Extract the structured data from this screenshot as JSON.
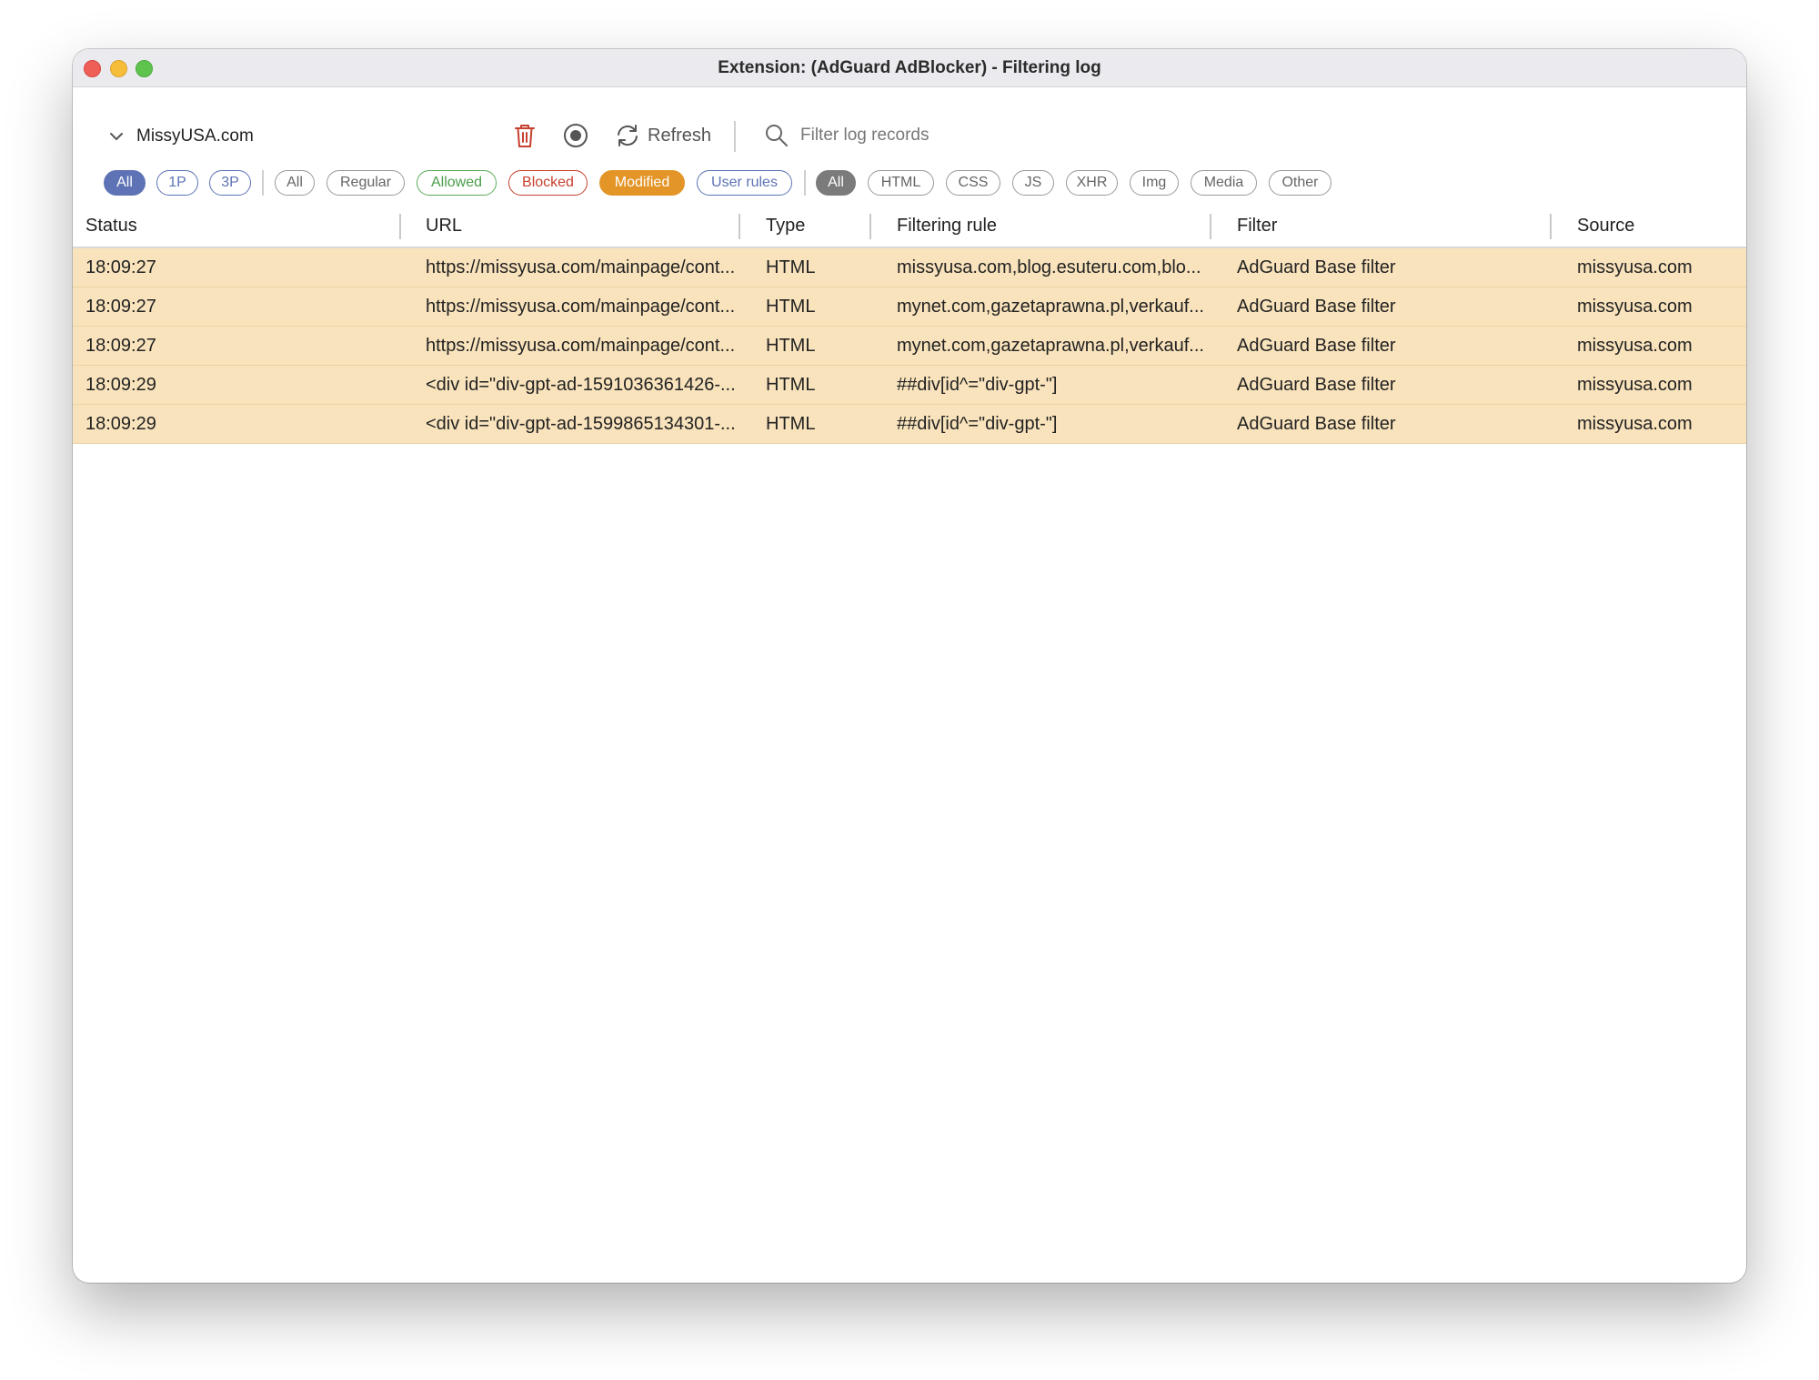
{
  "window": {
    "title": "Extension: (AdGuard AdBlocker) - Filtering log"
  },
  "toolbar": {
    "site": "MissyUSA.com",
    "refresh_label": "Refresh",
    "search_placeholder": "Filter log records"
  },
  "filters": {
    "party": [
      "All",
      "1P",
      "3P"
    ],
    "status": [
      "All",
      "Regular",
      "Allowed",
      "Blocked",
      "Modified",
      "User rules"
    ],
    "types": [
      "All",
      "HTML",
      "CSS",
      "JS",
      "XHR",
      "Img",
      "Media",
      "Other"
    ]
  },
  "table": {
    "columns": [
      "Status",
      "URL",
      "Type",
      "Filtering rule",
      "Filter",
      "Source"
    ],
    "rows": [
      {
        "status": "18:09:27",
        "url": "https://missyusa.com/mainpage/cont...",
        "type": "HTML",
        "rule": "missyusa.com,blog.esuteru.com,blo...",
        "filter": "AdGuard Base filter",
        "source": "missyusa.com"
      },
      {
        "status": "18:09:27",
        "url": "https://missyusa.com/mainpage/cont...",
        "type": "HTML",
        "rule": "mynet.com,gazetaprawna.pl,verkauf...",
        "filter": "AdGuard Base filter",
        "source": "missyusa.com"
      },
      {
        "status": "18:09:27",
        "url": "https://missyusa.com/mainpage/cont...",
        "type": "HTML",
        "rule": "mynet.com,gazetaprawna.pl,verkauf...",
        "filter": "AdGuard Base filter",
        "source": "missyusa.com"
      },
      {
        "status": "18:09:29",
        "url": "<div id=\"div-gpt-ad-1591036361426-...",
        "type": "HTML",
        "rule": "##div[id^=\"div-gpt-\"]",
        "filter": "AdGuard Base filter",
        "source": "missyusa.com"
      },
      {
        "status": "18:09:29",
        "url": "<div id=\"div-gpt-ad-1599865134301-...",
        "type": "HTML",
        "rule": "##div[id^=\"div-gpt-\"]",
        "filter": "AdGuard Base filter",
        "source": "missyusa.com"
      }
    ]
  },
  "colors": {
    "modified_row": "#f9e3bc",
    "party_accent": "#5e73b5",
    "modified_accent": "#e39528",
    "blocked_accent": "#c8402f",
    "allowed_accent": "#5aab5a",
    "trash_icon": "#c8402f"
  },
  "icons": [
    "chevron-down-icon",
    "trash-icon",
    "record-icon",
    "refresh-icon",
    "search-icon"
  ]
}
